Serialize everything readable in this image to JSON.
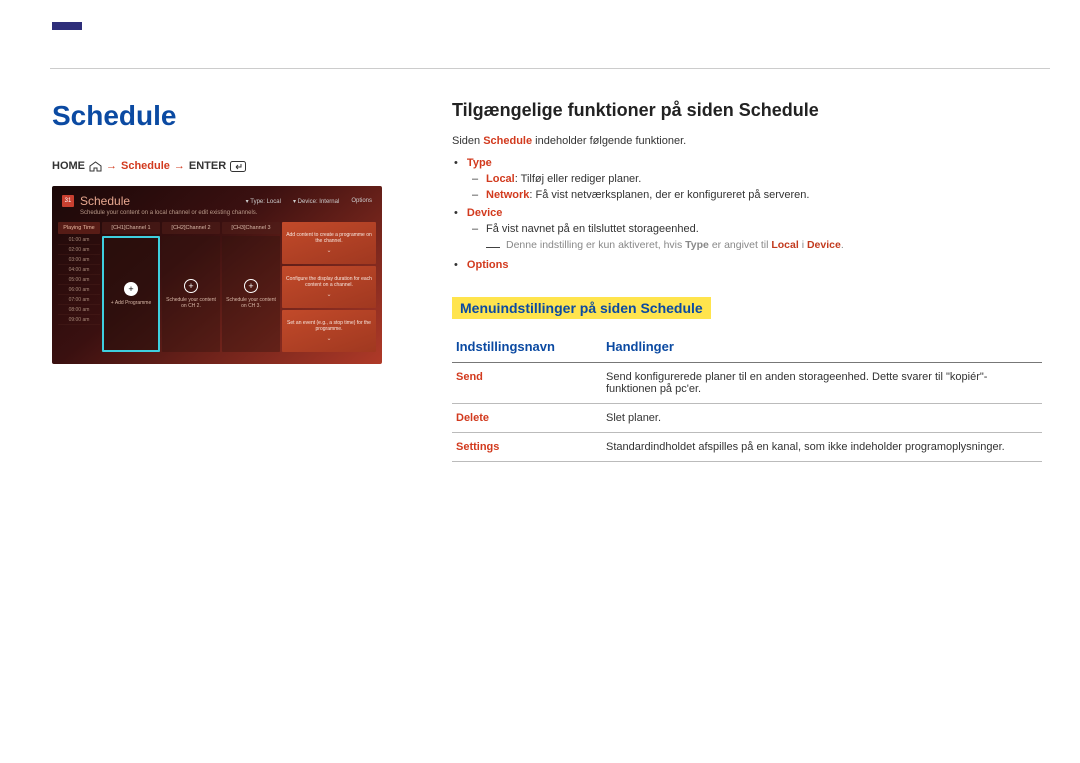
{
  "left": {
    "title": "Schedule",
    "breadcrumb": {
      "home": "HOME",
      "arrow": "→",
      "schedule": "Schedule",
      "enter": "ENTER"
    },
    "mock": {
      "cal_day": "31",
      "title": "Schedule",
      "type_label": "Type: Local",
      "device_label": "Device: Internal",
      "options_label": "Options",
      "subtitle": "Schedule your content on a local channel or edit existing channels.",
      "time_head": "Playing Time",
      "times": [
        "01:00 am",
        "02:00 am",
        "03:00 am",
        "04:00 am",
        "05:00 am",
        "06:00 am",
        "07:00 am",
        "08:00 am",
        "09:00 am"
      ],
      "channels": [
        {
          "head": "[CH1]Channel 1",
          "label": "+ Add Programme",
          "active": true
        },
        {
          "head": "[CH2]Channel 2",
          "label": "Schedule your content on CH 2.",
          "active": false
        },
        {
          "head": "[CH3]Channel 3",
          "label": "Schedule your content on CH 3.",
          "active": false
        }
      ],
      "info": [
        "Add content to create a programme on the channel.",
        "Configure the display duration for each content on a channel.",
        "Set an event (e.g., a stop time) for the programme."
      ]
    }
  },
  "right": {
    "h2": "Tilgængelige funktioner på siden Schedule",
    "intro_pre": "Siden ",
    "intro_bold": "Schedule",
    "intro_post": " indeholder følgende funktioner.",
    "funcs": {
      "type": {
        "name": "Type",
        "local_b": "Local",
        "local_t": ": Tilføj eller rediger planer.",
        "network_b": "Network",
        "network_t": ": Få vist netværksplanen, der er konfigureret på serveren."
      },
      "device": {
        "name": "Device",
        "line1": "Få vist navnet på en tilsluttet storageenhed.",
        "note_pre": "Denne indstilling er kun aktiveret, hvis ",
        "note_type": "Type",
        "note_mid": " er angivet til ",
        "note_local": "Local",
        "note_i": " i ",
        "note_device": "Device",
        "note_end": "."
      },
      "options": {
        "name": "Options"
      }
    },
    "h3": "Menuindstillinger på siden Schedule",
    "table": {
      "header_name": "Indstillingsnavn",
      "header_action": "Handlinger",
      "rows": [
        {
          "name": "Send",
          "action": "Send konfigurerede planer til en anden storageenhed. Dette svarer til \"kopiér\"-funktionen på pc'er."
        },
        {
          "name": "Delete",
          "action": "Slet planer."
        },
        {
          "name": "Settings",
          "action": "Standardindholdet afspilles på en kanal, som ikke indeholder programoplysninger."
        }
      ]
    }
  }
}
